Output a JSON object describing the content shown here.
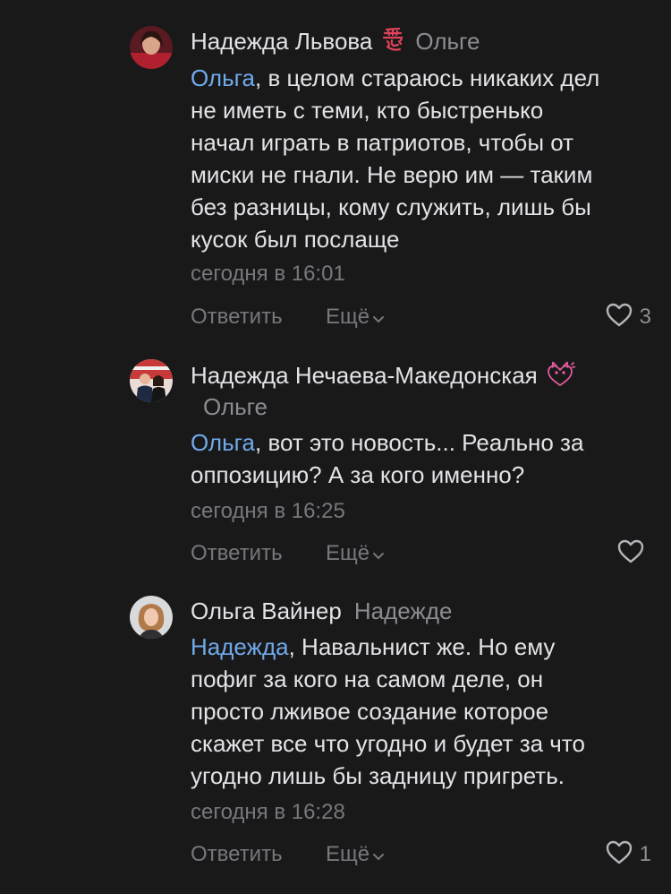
{
  "comments": [
    {
      "author": "Надежда Львова",
      "badge_icon": "love-kanji-icon",
      "reply_to": "Ольге",
      "mention": "Ольга",
      "text_lines": [
        ", в целом стараюсь никаких дел",
        "не иметь с теми, кто быстренько",
        "начал играть в патриотов, чтобы от",
        "миски не гнали. Не верю им — таким",
        "без разницы, кому служить, лишь бы",
        "кусок был послаще"
      ],
      "time": "сегодня в 16:01",
      "reply_label": "Ответить",
      "more_label": "Ещё",
      "likes": "3"
    },
    {
      "author": "Надежда Нечаева-Македонская",
      "badge_icon": "cat-heart-icon",
      "reply_to": "Ольге",
      "mention": "Ольга",
      "text_lines": [
        ", вот это новость... Реально за",
        "оппозицию? А за кого именно?"
      ],
      "time": "сегодня в 16:25",
      "reply_label": "Ответить",
      "more_label": "Ещё",
      "likes": ""
    },
    {
      "author": "Ольга Вайнер",
      "reply_to": "Надежде",
      "mention": "Надежда",
      "text_lines": [
        ", Навальнист же. Но ему",
        "пофиг за кого на самом деле, он",
        "просто лживое создание которое",
        "скажет все что угодно и будет за что",
        "угодно лишь бы задницу пригреть."
      ],
      "time": "сегодня в 16:28",
      "reply_label": "Ответить",
      "more_label": "Ещё",
      "likes": "1"
    }
  ],
  "colors": {
    "background": "#19191a",
    "text": "#e2e3e6",
    "secondary": "#76787d",
    "mention": "#71aaeb",
    "badge": "#e0435a"
  }
}
